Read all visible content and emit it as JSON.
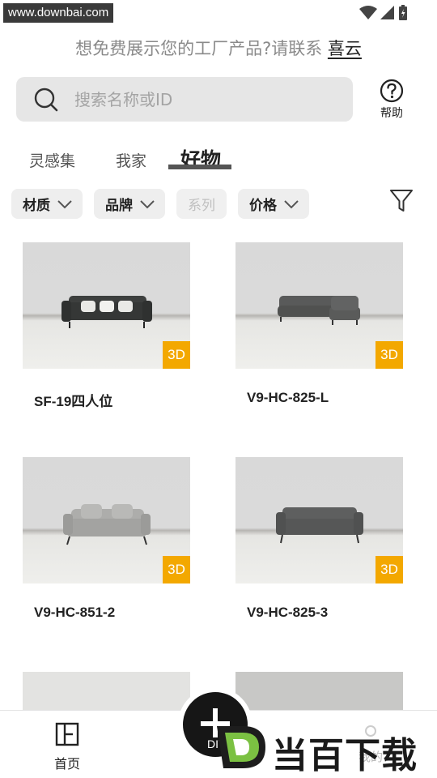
{
  "status_bar": {
    "watermark": "www.downbai.com"
  },
  "promo": {
    "text": "想免费展示您的工厂产品?请联系 ",
    "link": "喜云"
  },
  "search": {
    "placeholder": "搜索名称或ID",
    "value": ""
  },
  "help": {
    "label": "帮助"
  },
  "tabs": [
    {
      "label": "灵感集",
      "active": false
    },
    {
      "label": "我家",
      "active": false
    },
    {
      "label": "好物",
      "active": true
    }
  ],
  "filters": [
    {
      "label": "材质",
      "enabled": true
    },
    {
      "label": "品牌",
      "enabled": true
    },
    {
      "label": "系列",
      "enabled": false
    },
    {
      "label": "价格",
      "enabled": true
    }
  ],
  "products": [
    {
      "title": "SF-19四人位",
      "badge": "3D",
      "icon": "sofa-three-seat-dark"
    },
    {
      "title": "V9-HC-825-L",
      "badge": "3D",
      "icon": "sofa-l-shaped-grey"
    },
    {
      "title": "V9-HC-851-2",
      "badge": "3D",
      "icon": "sofa-two-seat-light"
    },
    {
      "title": "V9-HC-825-3",
      "badge": "3D",
      "icon": "sofa-three-seat-grey"
    }
  ],
  "bottom_nav": {
    "home_label": "首页",
    "center_label": "DIY",
    "mine_label": "我的"
  },
  "site_logo": {
    "text": "当百下载",
    "letter": "D"
  },
  "colors": {
    "badge": "#f3a800",
    "fab": "#161616",
    "logo_green": "#7bc142"
  }
}
